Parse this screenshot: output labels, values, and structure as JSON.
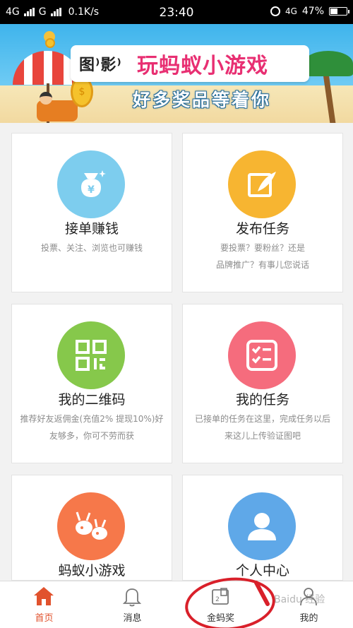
{
  "status_bar": {
    "left_net1": "4G",
    "left_net2": "G",
    "speed": "0.1K/s",
    "time": "23:40",
    "right_net": "4G",
    "battery_percent": "47%",
    "battery_level": 0.47
  },
  "banner": {
    "brand": "图⁾影⁾",
    "headline": "玩蚂蚁小游戏",
    "subline": "好多奖品等着你",
    "coin_symbol": "$"
  },
  "cards": [
    {
      "title": "接单赚钱",
      "desc": [
        "投票、关注、浏览也可赚钱"
      ],
      "color": "#7dcdee",
      "icon": "money-bag-icon"
    },
    {
      "title": "发布任务",
      "desc": [
        "要投票？要粉丝？还是",
        "品牌推广？有事儿您说话"
      ],
      "color": "#f7b531",
      "icon": "feather-edit-icon"
    },
    {
      "title": "我的二维码",
      "desc": [
        "推荐好友返佣金(充值2% 提现10%)好",
        "友够多，你可不劳而获"
      ],
      "color": "#86c84b",
      "icon": "qr-code-icon"
    },
    {
      "title": "我的任务",
      "desc": [
        "已接单的任务在这里，完成任务以后",
        "来这儿上传验证图吧"
      ],
      "color": "#f56c7d",
      "icon": "checklist-icon"
    },
    {
      "title": "蚂蚁小游戏",
      "desc": [],
      "color": "#f6784a",
      "icon": "ant-icon"
    },
    {
      "title": "个人中心",
      "desc": [],
      "color": "#5fa8e8",
      "icon": "user-icon"
    }
  ],
  "tabbar": {
    "items": [
      {
        "label": "首页",
        "icon": "home-icon",
        "active": true
      },
      {
        "label": "消息",
        "icon": "bell-icon",
        "active": false
      },
      {
        "label": "金蚂奖",
        "icon": "ticket-icon",
        "active": false
      },
      {
        "label": "我的",
        "icon": "person-icon",
        "active": false
      }
    ]
  },
  "watermark": "Baidu 经验",
  "colors": {
    "accent": "#e1522d",
    "annotation": "#d9202a"
  }
}
